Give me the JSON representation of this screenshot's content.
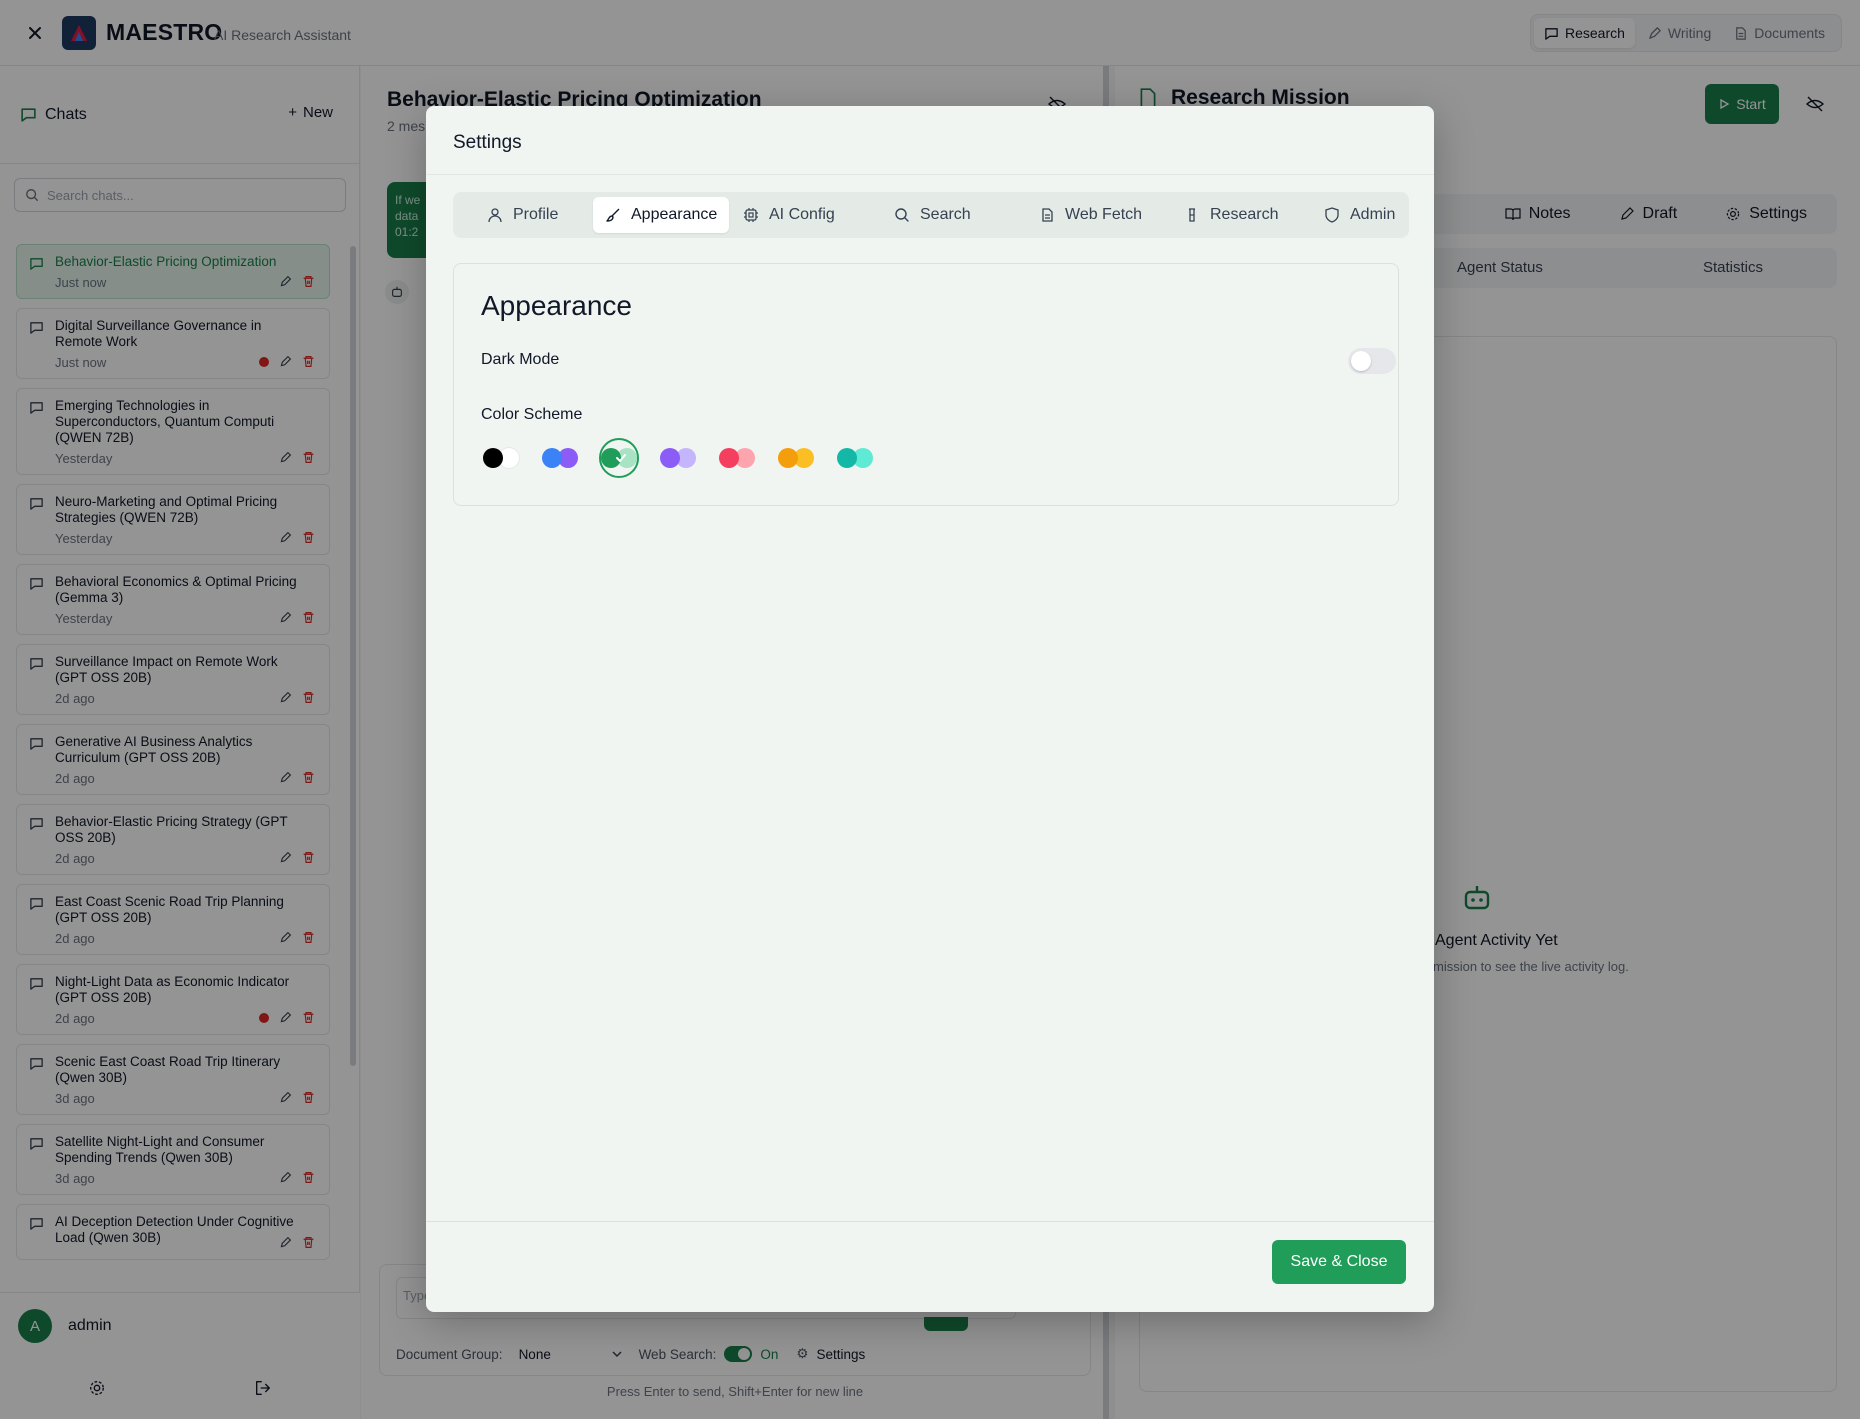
{
  "app": {
    "brand": "MAESTRO",
    "subtitle": "AI Research Assistant",
    "modes": [
      "Research",
      "Writing",
      "Documents"
    ],
    "active_mode": "Research"
  },
  "sidebar": {
    "title": "Chats",
    "new_label": "New",
    "search_placeholder": "Search chats...",
    "chats": [
      {
        "title": "Behavior-Elastic Pricing Optimization",
        "time": "Just now",
        "active": true,
        "dot": false
      },
      {
        "title": "Digital Surveillance Governance in Remote Work",
        "time": "Just now",
        "active": false,
        "dot": true
      },
      {
        "title": "Emerging Technologies in Superconductors, Quantum Computi (QWEN 72B)",
        "time": "Yesterday",
        "active": false,
        "dot": false
      },
      {
        "title": "Neuro-Marketing and Optimal Pricing Strategies (QWEN 72B)",
        "time": "Yesterday",
        "active": false,
        "dot": false
      },
      {
        "title": "Behavioral Economics & Optimal Pricing (Gemma 3)",
        "time": "Yesterday",
        "active": false,
        "dot": false
      },
      {
        "title": "Surveillance Impact on Remote Work (GPT OSS 20B)",
        "time": "2d ago",
        "active": false,
        "dot": false
      },
      {
        "title": "Generative AI Business Analytics Curriculum (GPT OSS 20B)",
        "time": "2d ago",
        "active": false,
        "dot": false
      },
      {
        "title": "Behavior-Elastic Pricing Strategy (GPT OSS 20B)",
        "time": "2d ago",
        "active": false,
        "dot": false
      },
      {
        "title": "East Coast Scenic Road Trip Planning (GPT OSS 20B)",
        "time": "2d ago",
        "active": false,
        "dot": false
      },
      {
        "title": "Night-Light Data as Economic Indicator (GPT OSS 20B)",
        "time": "2d ago",
        "active": false,
        "dot": true
      },
      {
        "title": "Scenic East Coast Road Trip Itinerary (Qwen 30B)",
        "time": "3d ago",
        "active": false,
        "dot": false
      },
      {
        "title": "Satellite Night-Light and Consumer Spending Trends (Qwen 30B)",
        "time": "3d ago",
        "active": false,
        "dot": false
      },
      {
        "title": "AI Deception Detection Under Cognitive Load (Qwen 30B)",
        "time": "",
        "active": false,
        "dot": false
      }
    ],
    "user": {
      "initial": "A",
      "name": "admin"
    }
  },
  "chat": {
    "title": "Behavior-Elastic Pricing Optimization",
    "subtitle": "2 mes",
    "bubble_text": "If we data 01:2",
    "input_placeholder": "Type",
    "document_group_label": "Document Group:",
    "document_group_value": "None",
    "web_search_label": "Web Search:",
    "web_search_state": "On",
    "settings_label": "Settings",
    "hint": "Press Enter to send, Shift+Enter for new line"
  },
  "research": {
    "title": "Research Mission",
    "start_label": "Start",
    "tabs": [
      "Notes",
      "Draft",
      "Settings"
    ],
    "subtabs": [
      "Agent Status",
      "Statistics"
    ],
    "empty_title": "Agent Activity Yet",
    "empty_sub": "mission to see the live activity log."
  },
  "modal": {
    "title": "Settings",
    "tabs": [
      "Profile",
      "Appearance",
      "AI Config",
      "Search",
      "Web Fetch",
      "Research",
      "Admin"
    ],
    "active_tab": "Appearance",
    "section_title": "Appearance",
    "dark_mode_label": "Dark Mode",
    "dark_mode_enabled": false,
    "color_scheme_label": "Color Scheme",
    "color_schemes": [
      {
        "name": "default",
        "colors": [
          "#000000",
          "#ffffff"
        ],
        "selected": false
      },
      {
        "name": "blue",
        "colors": [
          "#3b82f6",
          "#8b5cf6"
        ],
        "selected": false
      },
      {
        "name": "emerald",
        "colors": [
          "#1f9d59",
          "#a7e3c4"
        ],
        "selected": true
      },
      {
        "name": "purple",
        "colors": [
          "#8b5cf6",
          "#c4b5fd"
        ],
        "selected": false
      },
      {
        "name": "rose",
        "colors": [
          "#f43f5e",
          "#fda4af"
        ],
        "selected": false
      },
      {
        "name": "amber",
        "colors": [
          "#f59e0b",
          "#fbbf24"
        ],
        "selected": false
      },
      {
        "name": "teal",
        "colors": [
          "#14b8a6",
          "#5eead4"
        ],
        "selected": false
      }
    ],
    "save_label": "Save & Close"
  },
  "colors": {
    "accent": "#1f9d59",
    "accent_dark": "#1a7f4b",
    "danger": "#dc2626"
  }
}
